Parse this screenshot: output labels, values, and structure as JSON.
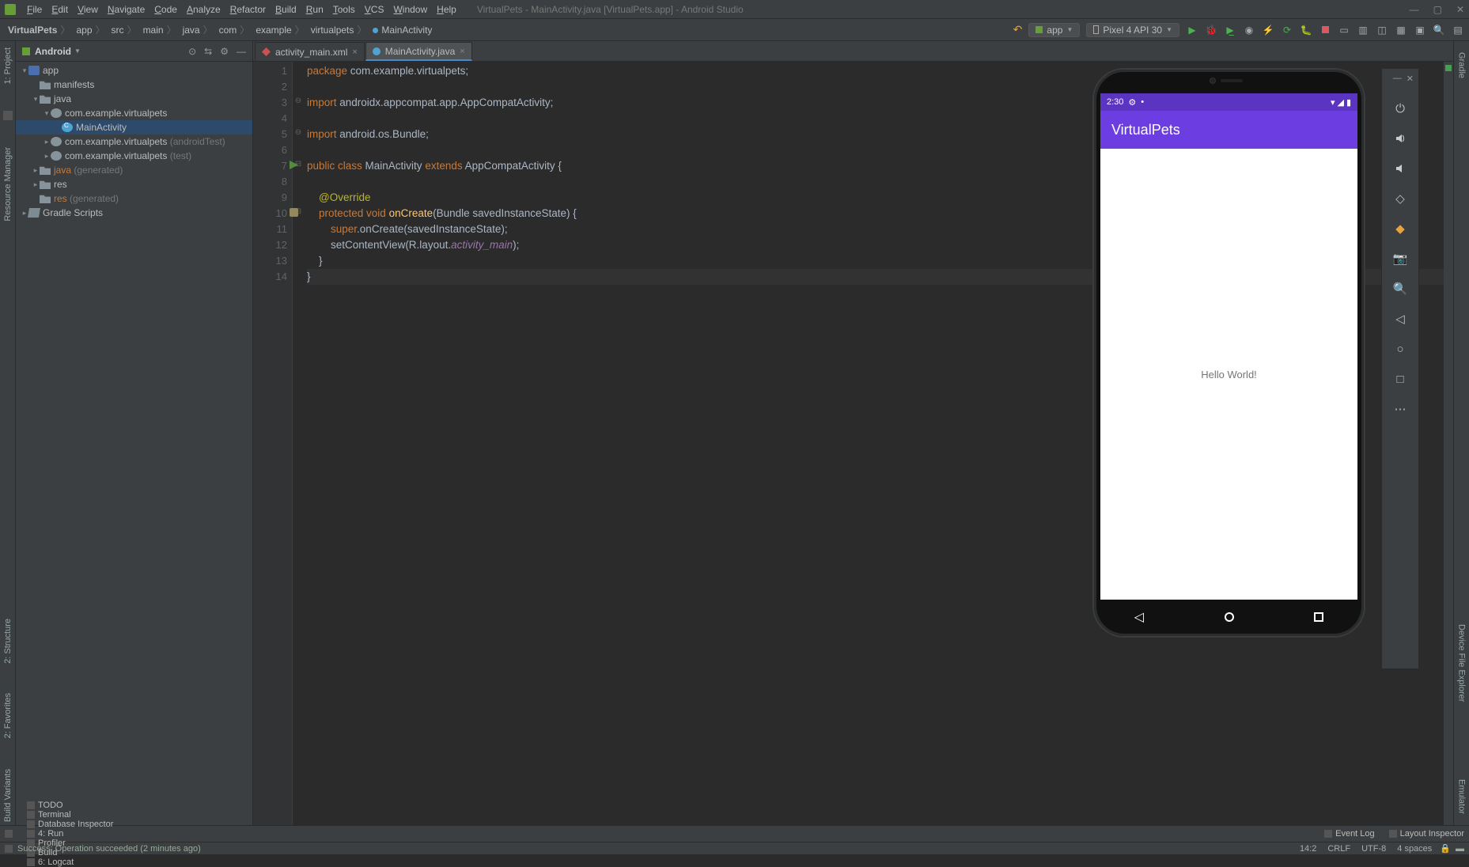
{
  "window_title": "VirtualPets - MainActivity.java [VirtualPets.app] - Android Studio",
  "menu": [
    "File",
    "Edit",
    "View",
    "Navigate",
    "Code",
    "Analyze",
    "Refactor",
    "Build",
    "Run",
    "Tools",
    "VCS",
    "Window",
    "Help"
  ],
  "breadcrumbs": [
    "VirtualPets",
    "app",
    "src",
    "main",
    "java",
    "com",
    "example",
    "virtualpets",
    "MainActivity"
  ],
  "run_config": "app",
  "device": "Pixel 4 API 30",
  "project_panel_title": "Android",
  "tree": [
    {
      "d": 1,
      "a": "open",
      "i": "mod",
      "t": "app"
    },
    {
      "d": 2,
      "a": "none",
      "i": "dir",
      "t": "manifests"
    },
    {
      "d": 2,
      "a": "open",
      "i": "dir",
      "t": "java"
    },
    {
      "d": 3,
      "a": "open",
      "i": "pkg",
      "t": "com.example.virtualpets"
    },
    {
      "d": 4,
      "a": "none",
      "i": "cls",
      "t": "MainActivity",
      "sel": true
    },
    {
      "d": 3,
      "a": "closed",
      "i": "pkg",
      "t": "com.example.virtualpets",
      "suf": "(androidTest)"
    },
    {
      "d": 3,
      "a": "closed",
      "i": "pkg",
      "t": "com.example.virtualpets",
      "suf": "(test)"
    },
    {
      "d": 2,
      "a": "closed",
      "i": "dir",
      "t": "java",
      "suf": "(generated)",
      "org": true
    },
    {
      "d": 2,
      "a": "closed",
      "i": "dir",
      "t": "res"
    },
    {
      "d": 2,
      "a": "none",
      "i": "dir",
      "t": "res",
      "suf": "(generated)",
      "org": true
    },
    {
      "d": 1,
      "a": "closed",
      "i": "scr",
      "t": "Gradle Scripts"
    }
  ],
  "tabs": [
    {
      "label": "activity_main.xml",
      "active": false,
      "icon": "xico"
    },
    {
      "label": "MainActivity.java",
      "active": true,
      "icon": "cico"
    }
  ],
  "code_lines": [
    {
      "n": 1,
      "h": "<span class='kw'>package</span> com.example.virtualpets;"
    },
    {
      "n": 2,
      "h": ""
    },
    {
      "n": 3,
      "h": "<span class='kw'>import</span> androidx.appcompat.app.AppCompatActivity;"
    },
    {
      "n": 4,
      "h": ""
    },
    {
      "n": 5,
      "h": "<span class='kw'>import</span> android.os.Bundle;"
    },
    {
      "n": 6,
      "h": ""
    },
    {
      "n": 7,
      "h": "<span class='kw'>public class</span> MainActivity <span class='kw'>extends</span> AppCompatActivity {",
      "mark": "run"
    },
    {
      "n": 8,
      "h": ""
    },
    {
      "n": 9,
      "h": "    <span class='ann'>@Override</span>"
    },
    {
      "n": 10,
      "h": "    <span class='kw'>protected void</span> <span class='fn'>onCreate</span>(Bundle savedInstanceState) {",
      "mark": "ic"
    },
    {
      "n": 11,
      "h": "        <span class='kw'>super</span>.onCreate(savedInstanceState);"
    },
    {
      "n": 12,
      "h": "        setContentView(R.layout.<span class='it'>activity_main</span>);"
    },
    {
      "n": 13,
      "h": "    }"
    },
    {
      "n": 14,
      "h": "}",
      "cur": true
    }
  ],
  "fold": {
    "3": "⊖",
    "5": "⊖",
    "7": "⊟",
    "10": "⊟"
  },
  "left_tabs": [
    "1: Project",
    "Resource Manager"
  ],
  "right_tabs_top": [
    "Gradle"
  ],
  "right_tabs_bottom": [
    "Device File Explorer",
    "Emulator"
  ],
  "bottom_tools": [
    "TODO",
    "Terminal",
    "Database Inspector",
    "4: Run",
    "Profiler",
    "Build",
    "6: Logcat"
  ],
  "bottom_right": [
    "Event Log",
    "Layout Inspector"
  ],
  "status_msg": "Success: Operation succeeded (2 minutes ago)",
  "status_right": [
    "14:2",
    "CRLF",
    "UTF-8",
    "4 spaces"
  ],
  "emu": {
    "time": "2:30",
    "app_title": "VirtualPets",
    "body": "Hello World!",
    "tool_icons": [
      "⏻",
      "🔊",
      "🔉",
      "⤢",
      "◈",
      "📷",
      "⌕",
      "◁",
      "◯",
      "◻",
      "⋯"
    ]
  }
}
